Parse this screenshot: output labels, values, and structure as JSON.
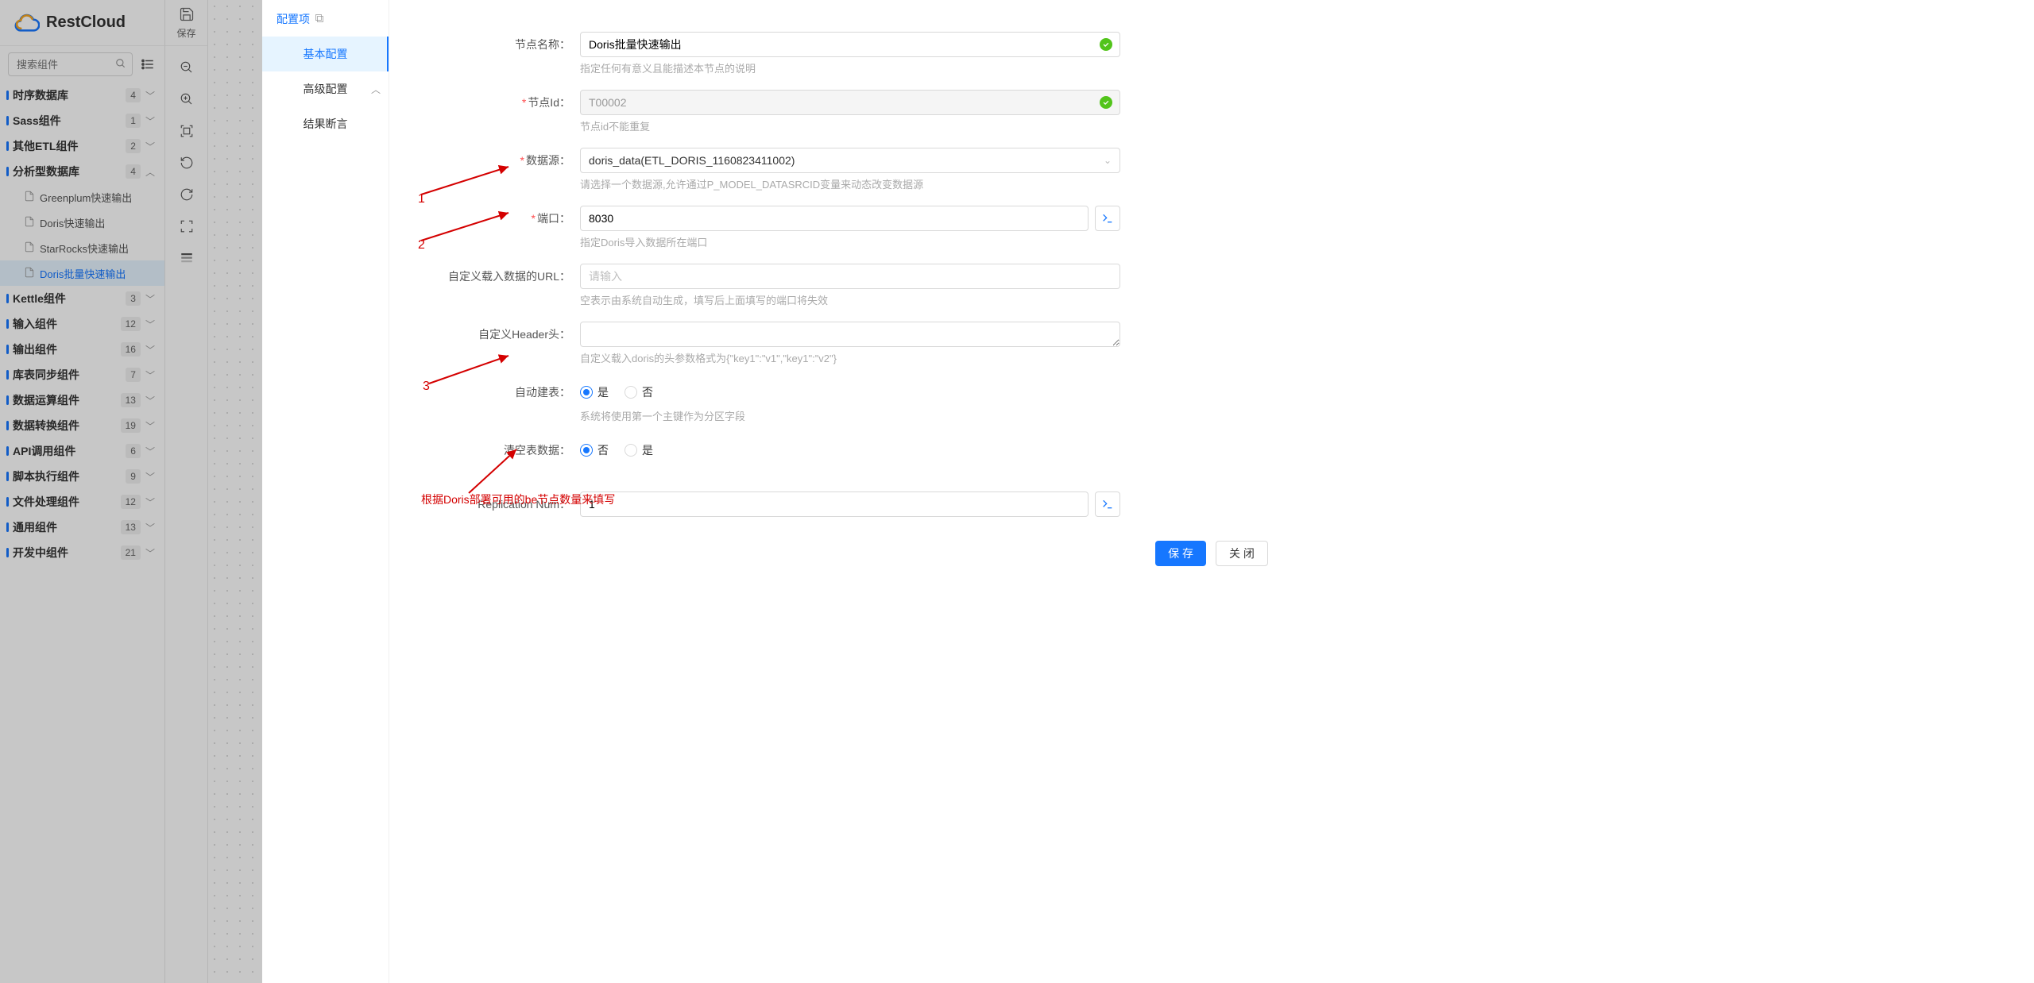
{
  "logo": {
    "text": "RestCloud"
  },
  "save": {
    "label": "保存"
  },
  "search": {
    "placeholder": "搜索组件"
  },
  "nav": [
    {
      "label": "时序数据库",
      "badge": "4",
      "expanded": false
    },
    {
      "label": "Sass组件",
      "badge": "1",
      "expanded": false
    },
    {
      "label": "其他ETL组件",
      "badge": "2",
      "expanded": false
    },
    {
      "label": "分析型数据库",
      "badge": "4",
      "expanded": true,
      "children": [
        {
          "label": "Greenplum快速输出",
          "active": false
        },
        {
          "label": "Doris快速输出",
          "active": false
        },
        {
          "label": "StarRocks快速输出",
          "active": false
        },
        {
          "label": "Doris批量快速输出",
          "active": true
        }
      ]
    },
    {
      "label": "Kettle组件",
      "badge": "3",
      "expanded": false
    },
    {
      "label": "输入组件",
      "badge": "12",
      "expanded": false
    },
    {
      "label": "输出组件",
      "badge": "16",
      "expanded": false
    },
    {
      "label": "库表同步组件",
      "badge": "7",
      "expanded": false
    },
    {
      "label": "数据运算组件",
      "badge": "13",
      "expanded": false
    },
    {
      "label": "数据转换组件",
      "badge": "19",
      "expanded": false
    },
    {
      "label": "API调用组件",
      "badge": "6",
      "expanded": false
    },
    {
      "label": "脚本执行组件",
      "badge": "9",
      "expanded": false
    },
    {
      "label": "文件处理组件",
      "badge": "12",
      "expanded": false
    },
    {
      "label": "通用组件",
      "badge": "13",
      "expanded": false
    },
    {
      "label": "开发中组件",
      "badge": "21",
      "expanded": false
    }
  ],
  "panel": {
    "header": "配置项",
    "tabs": {
      "basic": "基本配置",
      "advanced": "高级配置",
      "assert": "结果断言"
    },
    "form": {
      "node_name": {
        "label": "节点名称：",
        "value": "Doris批量快速输出",
        "hint": "指定任何有意义且能描述本节点的说明"
      },
      "node_id": {
        "label": "节点Id：",
        "value": "T00002",
        "hint": "节点id不能重复"
      },
      "datasource": {
        "label": "数据源：",
        "value": "doris_data(ETL_DORIS_1160823411002)",
        "hint": "请选择一个数据源,允许通过P_MODEL_DATASRCID变量来动态改变数据源"
      },
      "port": {
        "label": "端口：",
        "value": "8030",
        "hint": "指定Doris导入数据所在端口"
      },
      "load_url": {
        "label": "自定义载入数据的URL：",
        "placeholder": "请输入",
        "hint": "空表示由系统自动生成，填写后上面填写的端口将失效"
      },
      "header": {
        "label": "自定义Header头：",
        "hint": "自定义载入doris的头参数格式为{\"key1\":\"v1\",\"key1\":\"v2\"}"
      },
      "auto_table": {
        "label": "自动建表：",
        "yes": "是",
        "no": "否",
        "hint": "系统将使用第一个主键作为分区字段"
      },
      "clear": {
        "label": "清空表数据：",
        "yes": "是",
        "no": "否"
      },
      "repl": {
        "label": "Replication Num：",
        "value": "1"
      }
    },
    "actions": {
      "save": "保 存",
      "close": "关 闭"
    }
  },
  "anno": {
    "n1": "1",
    "n2": "2",
    "n3": "3",
    "note": "根据Doris部署可用的be节点数量来填写"
  }
}
